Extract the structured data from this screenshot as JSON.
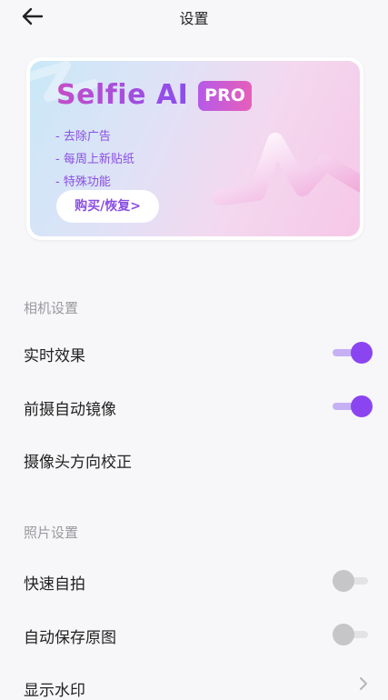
{
  "header": {
    "title": "设置",
    "back_icon": "arrow-left-icon"
  },
  "banner": {
    "brand": "Selfie AI",
    "badge": "PRO",
    "benefits": [
      "- 去除广告",
      "- 每周上新贴纸",
      "- 特殊功能"
    ],
    "buy_label": "购买/恢复>",
    "accent_color": "#8b4fe3"
  },
  "camera_section": {
    "header": "相机设置",
    "items": [
      {
        "label": "实时效果",
        "control": "toggle",
        "on": true
      },
      {
        "label": "前摄自动镜像",
        "control": "toggle",
        "on": true
      },
      {
        "label": "摄像头方向校正",
        "control": "none"
      }
    ]
  },
  "photo_section": {
    "header": "照片设置",
    "items": [
      {
        "label": "快速自拍",
        "control": "toggle",
        "on": false
      },
      {
        "label": "自动保存原图",
        "control": "toggle",
        "on": false
      },
      {
        "label": "显示水印",
        "control": "chevron"
      }
    ]
  },
  "colors": {
    "toggle_on": "#8b45f0",
    "toggle_off": "#c6c6c9",
    "section_header": "#9a9a9e"
  }
}
